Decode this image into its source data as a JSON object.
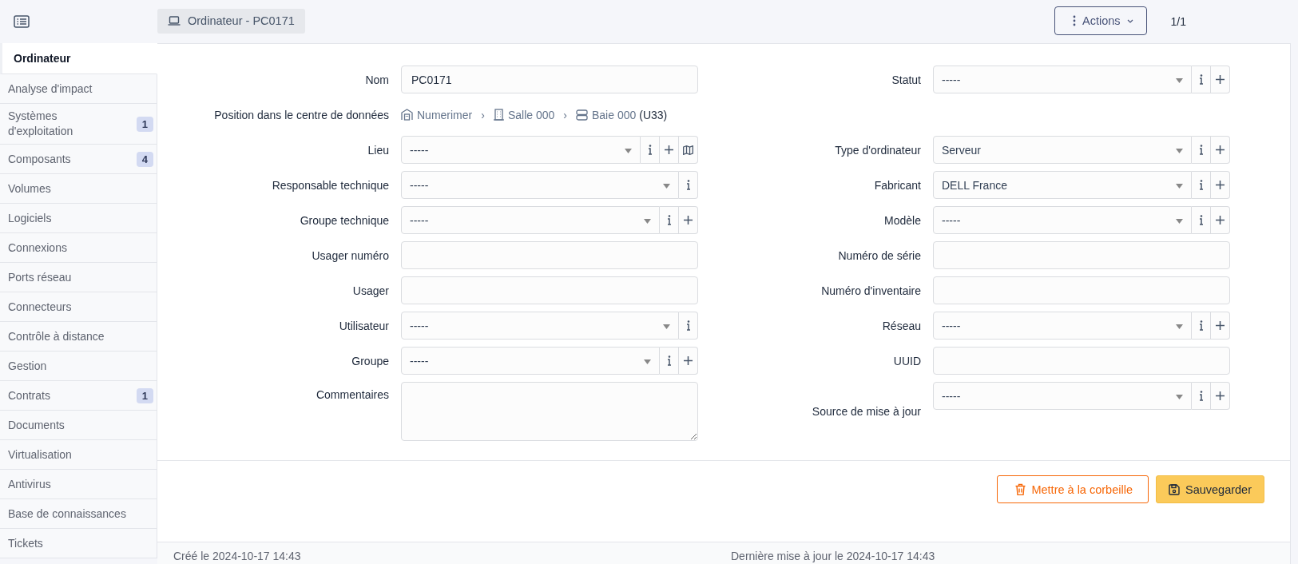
{
  "header": {
    "title": "Ordinateur - PC0171",
    "actions": "Actions",
    "pager": "1/1"
  },
  "sidebar": {
    "tabs": [
      {
        "label": "Ordinateur",
        "selected": true
      },
      {
        "label": "Analyse d'impact",
        "selected": false
      },
      {
        "label": "Systèmes d'exploitation",
        "badge": "1",
        "selected": false
      },
      {
        "label": "Composants",
        "badge": "4",
        "selected": false
      },
      {
        "label": "Volumes",
        "selected": false
      },
      {
        "label": "Logiciels",
        "selected": false
      },
      {
        "label": "Connexions",
        "selected": false
      },
      {
        "label": "Ports réseau",
        "selected": false
      },
      {
        "label": "Connecteurs",
        "selected": false
      },
      {
        "label": "Contrôle à distance",
        "selected": false
      },
      {
        "label": "Gestion",
        "selected": false
      },
      {
        "label": "Contrats",
        "badge": "1",
        "selected": false
      },
      {
        "label": "Documents",
        "selected": false
      },
      {
        "label": "Virtualisation",
        "selected": false
      },
      {
        "label": "Antivirus",
        "selected": false
      },
      {
        "label": "Base de connaissances",
        "selected": false
      },
      {
        "label": "Tickets",
        "selected": false
      }
    ]
  },
  "form": {
    "rows": [
      {
        "left": {
          "label": "Nom",
          "kind": "text",
          "value": "PC0171"
        },
        "right": {
          "label": "Statut",
          "kind": "select",
          "value": "-----",
          "buttons": [
            {
              "kind": "info"
            },
            {
              "kind": "add"
            }
          ]
        }
      },
      {
        "left": {
          "label": "Position dans le centre de données",
          "kind": "breadcrumb",
          "parts": [
            {
              "text": "Numerimer"
            },
            {
              "separator": "›",
              "text": "Salle 000"
            },
            {
              "separator": "›",
              "text": "Baie 000"
            }
          ],
          "suffix": "(U33)"
        }
      },
      {
        "left": {
          "label": "Lieu",
          "kind": "select",
          "value": "-----",
          "buttons": [
            {
              "kind": "info"
            },
            {
              "kind": "add"
            },
            {
              "kind": "map"
            }
          ]
        },
        "right": {
          "label": "Type d'ordinateur",
          "kind": "select",
          "value": "Serveur",
          "buttons": [
            {
              "kind": "info"
            },
            {
              "kind": "add"
            }
          ]
        }
      },
      {
        "left": {
          "label": "Responsable technique",
          "kind": "select",
          "value": "-----",
          "buttons": [
            {
              "kind": "info"
            }
          ]
        },
        "right": {
          "label": "Fabricant",
          "kind": "select",
          "value": "DELL France",
          "buttons": [
            {
              "kind": "info"
            },
            {
              "kind": "add"
            }
          ]
        }
      },
      {
        "left": {
          "label": "Groupe technique",
          "kind": "select",
          "value": "-----",
          "buttons": [
            {
              "kind": "info"
            },
            {
              "kind": "add"
            }
          ]
        },
        "right": {
          "label": "Modèle",
          "kind": "select",
          "value": "-----",
          "buttons": [
            {
              "kind": "info"
            },
            {
              "kind": "add"
            }
          ]
        }
      },
      {
        "left": {
          "label": "Usager numéro",
          "kind": "text"
        },
        "right": {
          "label": "Numéro de série",
          "kind": "text"
        }
      },
      {
        "left": {
          "label": "Usager",
          "kind": "text"
        },
        "right": {
          "label": "Numéro d'inventaire",
          "kind": "text"
        }
      },
      {
        "left": {
          "label": "Utilisateur",
          "kind": "select",
          "value": "-----",
          "buttons": [
            {
              "kind": "info"
            }
          ]
        },
        "right": {
          "label": "Réseau",
          "kind": "select",
          "value": "-----",
          "buttons": [
            {
              "kind": "info"
            },
            {
              "kind": "add"
            }
          ]
        }
      },
      {
        "left": {
          "label": "Groupe",
          "kind": "select",
          "value": "-----",
          "buttons": [
            {
              "kind": "info"
            },
            {
              "kind": "add"
            }
          ]
        },
        "right": {
          "label": "UUID",
          "kind": "text"
        }
      },
      {
        "left": {
          "label": "Commentaires",
          "kind": "textarea"
        },
        "right": {
          "label": "Source de mise à jour",
          "kind": "select",
          "value": "-----",
          "buttons": [
            {
              "kind": "info"
            },
            {
              "kind": "add"
            }
          ]
        }
      }
    ]
  },
  "actions": [
    {
      "label": "Mettre à la corbeille",
      "kind": "danger"
    },
    {
      "label": "Sauvegarder",
      "kind": "primary"
    }
  ],
  "footer": {
    "created": "Créé le 2024-10-17 14:43",
    "updated": "Dernière mise à jour le 2024-10-17 14:43"
  }
}
